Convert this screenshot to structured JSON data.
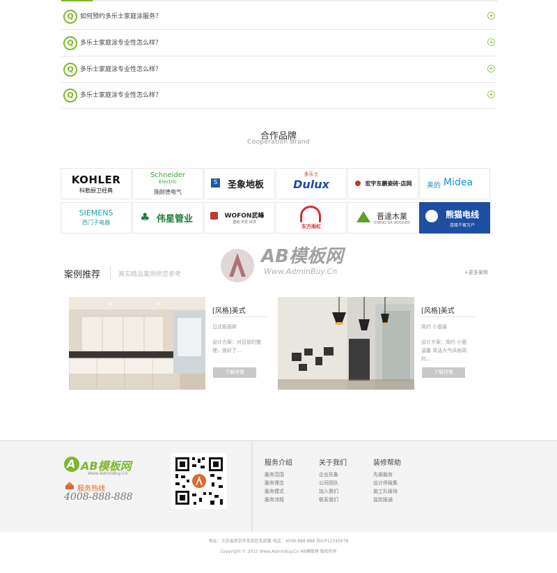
{
  "faq": {
    "items": [
      {
        "q": "Q",
        "text": "如何预约多乐士家庭涂服务？"
      },
      {
        "q": "Q",
        "text": "多乐士家庭涂专业性怎么样？"
      },
      {
        "q": "Q",
        "text": "多乐士家庭涂专业性怎么样？"
      },
      {
        "q": "Q",
        "text": "多乐士家庭涂专业性怎么样？"
      }
    ]
  },
  "brands": {
    "title": "合作品牌",
    "subtitle": "Cooperation Brand",
    "items": [
      {
        "name": "KOHLER",
        "sub": "科勒厨卫经典"
      },
      {
        "name": "Schneider",
        "name2": "Electric",
        "sub": "施耐德电气"
      },
      {
        "name": "圣象地板"
      },
      {
        "name": "Dulux",
        "sub": "多乐士"
      },
      {
        "name": "宏宇东鹏瓷砖·店网"
      },
      {
        "name": "美的",
        "name2": "Midea"
      },
      {
        "name": "SIEMENS",
        "sub": "西门子电器"
      },
      {
        "name": "伟星管业"
      },
      {
        "name": "WOFON武峰",
        "sub": "壁纸 天花 吊顶"
      },
      {
        "name": "东方雨虹"
      },
      {
        "name": "晋達木業",
        "sub": "SHENG DA WOODEN"
      },
      {
        "name": "熊猫电线",
        "sub": "连接千家万户"
      }
    ]
  },
  "cases": {
    "title": "案例推荐",
    "subtitle": "真实精品案例供您参考",
    "more": "+更多案例",
    "items": [
      {
        "title": "[风格]美式",
        "type": "日式板面砖",
        "design_label": "设计方案：",
        "design": "设计方案：对目前的整理，很好了...",
        "button": "了解详情"
      },
      {
        "title": "[风格]美式",
        "type": "简约 小面装",
        "design_label": "设计方案：",
        "design": "设计方案：简约 小面温馨 简洁大气风格简约...",
        "button": "了解详情"
      }
    ]
  },
  "watermark": {
    "text": "AB模板网",
    "url": "Www.AdminBuy.Cn"
  },
  "footer": {
    "logo": "AB模板网",
    "logo_url": "Www.AdminBuy.Cn",
    "hotline_label": "服务热线",
    "hotline": "4008-888-888",
    "columns": [
      {
        "title": "服务介绍",
        "links": [
          "服务范围",
          "服务理念",
          "服务模式",
          "服务流程"
        ]
      },
      {
        "title": "关于我们",
        "links": [
          "企业形象",
          "公司团队",
          "加入我们",
          "联系我们"
        ]
      },
      {
        "title": "装修帮助",
        "links": [
          "先装服务",
          "设计师报集",
          "施工队报培",
          "监控报通"
        ]
      }
    ],
    "address": "地址：江苏省南京市玄武区玄武路  电话：4008-888-888  苏ICP12345678",
    "copyright": "Copyright © 2015 Www.AdminBuy.Cn AB模板网 版权所有"
  },
  "colors": {
    "accent": "#7fb62f",
    "hotline": "#e3662c"
  }
}
